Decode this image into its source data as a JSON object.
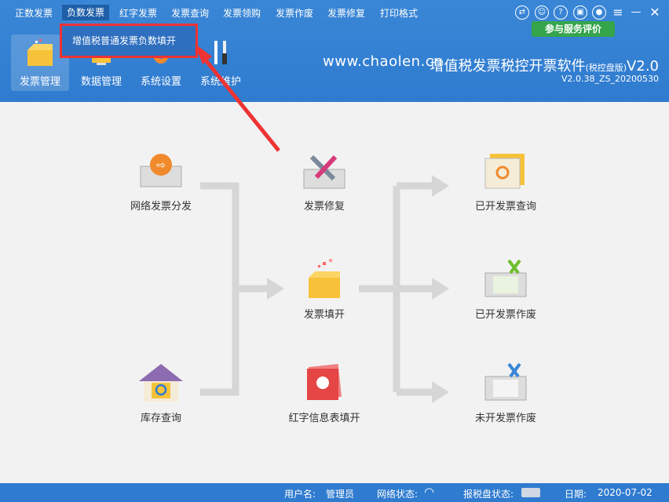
{
  "menu": [
    "正数发票",
    "负数发票",
    "红字发票",
    "发票查询",
    "发票领购",
    "发票作废",
    "发票修复",
    "打印格式"
  ],
  "dropdown_item": "增值税普通发票负数填开",
  "toolbar": [
    "发票管理",
    "数据管理",
    "系统设置",
    "系统维护"
  ],
  "site": "www.chaolen.cn",
  "app_title": "增值税发票税控开票软件",
  "app_edition": "(税控盘版)",
  "app_ver_short": "V2.0",
  "version": "V2.0.38_ZS_20200530",
  "eval_button": "参与服务评价",
  "nodes": {
    "net_distribute": "网络发票分发",
    "inventory": "库存查询",
    "repair": "发票修复",
    "fill": "发票填开",
    "red_info": "红字信息表填开",
    "issued_query": "已开发票查询",
    "issued_void": "已开发票作废",
    "unissued_void": "未开发票作废"
  },
  "status": {
    "user_label": "用户名:",
    "user": "管理员",
    "net_label": "网络状态:",
    "disk_label": "报税盘状态:",
    "date_label": "日期:",
    "date": "2020-07-02"
  }
}
